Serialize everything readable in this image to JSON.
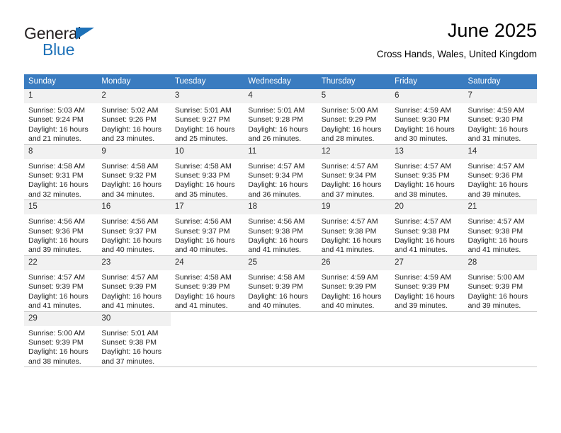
{
  "brand": {
    "line1": "General",
    "line2": "Blue",
    "triangle_color": "#1d71b8"
  },
  "header": {
    "title": "June 2025",
    "subtitle": "Cross Hands, Wales, United Kingdom"
  },
  "theme": {
    "header_row_bg": "#3a7cc0",
    "header_row_text": "#ffffff",
    "daynum_bg": "#f1f1f1",
    "cell_border": "#c8c8c8",
    "page_bg": "#ffffff"
  },
  "calendar": {
    "weekday_headers": [
      "Sunday",
      "Monday",
      "Tuesday",
      "Wednesday",
      "Thursday",
      "Friday",
      "Saturday"
    ],
    "weeks": [
      [
        {
          "day": "1",
          "sunrise": "Sunrise: 5:03 AM",
          "sunset": "Sunset: 9:24 PM",
          "daylight1": "Daylight: 16 hours",
          "daylight2": "and 21 minutes."
        },
        {
          "day": "2",
          "sunrise": "Sunrise: 5:02 AM",
          "sunset": "Sunset: 9:26 PM",
          "daylight1": "Daylight: 16 hours",
          "daylight2": "and 23 minutes."
        },
        {
          "day": "3",
          "sunrise": "Sunrise: 5:01 AM",
          "sunset": "Sunset: 9:27 PM",
          "daylight1": "Daylight: 16 hours",
          "daylight2": "and 25 minutes."
        },
        {
          "day": "4",
          "sunrise": "Sunrise: 5:01 AM",
          "sunset": "Sunset: 9:28 PM",
          "daylight1": "Daylight: 16 hours",
          "daylight2": "and 26 minutes."
        },
        {
          "day": "5",
          "sunrise": "Sunrise: 5:00 AM",
          "sunset": "Sunset: 9:29 PM",
          "daylight1": "Daylight: 16 hours",
          "daylight2": "and 28 minutes."
        },
        {
          "day": "6",
          "sunrise": "Sunrise: 4:59 AM",
          "sunset": "Sunset: 9:30 PM",
          "daylight1": "Daylight: 16 hours",
          "daylight2": "and 30 minutes."
        },
        {
          "day": "7",
          "sunrise": "Sunrise: 4:59 AM",
          "sunset": "Sunset: 9:30 PM",
          "daylight1": "Daylight: 16 hours",
          "daylight2": "and 31 minutes."
        }
      ],
      [
        {
          "day": "8",
          "sunrise": "Sunrise: 4:58 AM",
          "sunset": "Sunset: 9:31 PM",
          "daylight1": "Daylight: 16 hours",
          "daylight2": "and 32 minutes."
        },
        {
          "day": "9",
          "sunrise": "Sunrise: 4:58 AM",
          "sunset": "Sunset: 9:32 PM",
          "daylight1": "Daylight: 16 hours",
          "daylight2": "and 34 minutes."
        },
        {
          "day": "10",
          "sunrise": "Sunrise: 4:58 AM",
          "sunset": "Sunset: 9:33 PM",
          "daylight1": "Daylight: 16 hours",
          "daylight2": "and 35 minutes."
        },
        {
          "day": "11",
          "sunrise": "Sunrise: 4:57 AM",
          "sunset": "Sunset: 9:34 PM",
          "daylight1": "Daylight: 16 hours",
          "daylight2": "and 36 minutes."
        },
        {
          "day": "12",
          "sunrise": "Sunrise: 4:57 AM",
          "sunset": "Sunset: 9:34 PM",
          "daylight1": "Daylight: 16 hours",
          "daylight2": "and 37 minutes."
        },
        {
          "day": "13",
          "sunrise": "Sunrise: 4:57 AM",
          "sunset": "Sunset: 9:35 PM",
          "daylight1": "Daylight: 16 hours",
          "daylight2": "and 38 minutes."
        },
        {
          "day": "14",
          "sunrise": "Sunrise: 4:57 AM",
          "sunset": "Sunset: 9:36 PM",
          "daylight1": "Daylight: 16 hours",
          "daylight2": "and 39 minutes."
        }
      ],
      [
        {
          "day": "15",
          "sunrise": "Sunrise: 4:56 AM",
          "sunset": "Sunset: 9:36 PM",
          "daylight1": "Daylight: 16 hours",
          "daylight2": "and 39 minutes."
        },
        {
          "day": "16",
          "sunrise": "Sunrise: 4:56 AM",
          "sunset": "Sunset: 9:37 PM",
          "daylight1": "Daylight: 16 hours",
          "daylight2": "and 40 minutes."
        },
        {
          "day": "17",
          "sunrise": "Sunrise: 4:56 AM",
          "sunset": "Sunset: 9:37 PM",
          "daylight1": "Daylight: 16 hours",
          "daylight2": "and 40 minutes."
        },
        {
          "day": "18",
          "sunrise": "Sunrise: 4:56 AM",
          "sunset": "Sunset: 9:38 PM",
          "daylight1": "Daylight: 16 hours",
          "daylight2": "and 41 minutes."
        },
        {
          "day": "19",
          "sunrise": "Sunrise: 4:57 AM",
          "sunset": "Sunset: 9:38 PM",
          "daylight1": "Daylight: 16 hours",
          "daylight2": "and 41 minutes."
        },
        {
          "day": "20",
          "sunrise": "Sunrise: 4:57 AM",
          "sunset": "Sunset: 9:38 PM",
          "daylight1": "Daylight: 16 hours",
          "daylight2": "and 41 minutes."
        },
        {
          "day": "21",
          "sunrise": "Sunrise: 4:57 AM",
          "sunset": "Sunset: 9:38 PM",
          "daylight1": "Daylight: 16 hours",
          "daylight2": "and 41 minutes."
        }
      ],
      [
        {
          "day": "22",
          "sunrise": "Sunrise: 4:57 AM",
          "sunset": "Sunset: 9:39 PM",
          "daylight1": "Daylight: 16 hours",
          "daylight2": "and 41 minutes."
        },
        {
          "day": "23",
          "sunrise": "Sunrise: 4:57 AM",
          "sunset": "Sunset: 9:39 PM",
          "daylight1": "Daylight: 16 hours",
          "daylight2": "and 41 minutes."
        },
        {
          "day": "24",
          "sunrise": "Sunrise: 4:58 AM",
          "sunset": "Sunset: 9:39 PM",
          "daylight1": "Daylight: 16 hours",
          "daylight2": "and 41 minutes."
        },
        {
          "day": "25",
          "sunrise": "Sunrise: 4:58 AM",
          "sunset": "Sunset: 9:39 PM",
          "daylight1": "Daylight: 16 hours",
          "daylight2": "and 40 minutes."
        },
        {
          "day": "26",
          "sunrise": "Sunrise: 4:59 AM",
          "sunset": "Sunset: 9:39 PM",
          "daylight1": "Daylight: 16 hours",
          "daylight2": "and 40 minutes."
        },
        {
          "day": "27",
          "sunrise": "Sunrise: 4:59 AM",
          "sunset": "Sunset: 9:39 PM",
          "daylight1": "Daylight: 16 hours",
          "daylight2": "and 39 minutes."
        },
        {
          "day": "28",
          "sunrise": "Sunrise: 5:00 AM",
          "sunset": "Sunset: 9:39 PM",
          "daylight1": "Daylight: 16 hours",
          "daylight2": "and 39 minutes."
        }
      ],
      [
        {
          "day": "29",
          "sunrise": "Sunrise: 5:00 AM",
          "sunset": "Sunset: 9:39 PM",
          "daylight1": "Daylight: 16 hours",
          "daylight2": "and 38 minutes."
        },
        {
          "day": "30",
          "sunrise": "Sunrise: 5:01 AM",
          "sunset": "Sunset: 9:38 PM",
          "daylight1": "Daylight: 16 hours",
          "daylight2": "and 37 minutes."
        },
        {
          "day": "",
          "sunrise": "",
          "sunset": "",
          "daylight1": "",
          "daylight2": ""
        },
        {
          "day": "",
          "sunrise": "",
          "sunset": "",
          "daylight1": "",
          "daylight2": ""
        },
        {
          "day": "",
          "sunrise": "",
          "sunset": "",
          "daylight1": "",
          "daylight2": ""
        },
        {
          "day": "",
          "sunrise": "",
          "sunset": "",
          "daylight1": "",
          "daylight2": ""
        },
        {
          "day": "",
          "sunrise": "",
          "sunset": "",
          "daylight1": "",
          "daylight2": ""
        }
      ]
    ]
  }
}
